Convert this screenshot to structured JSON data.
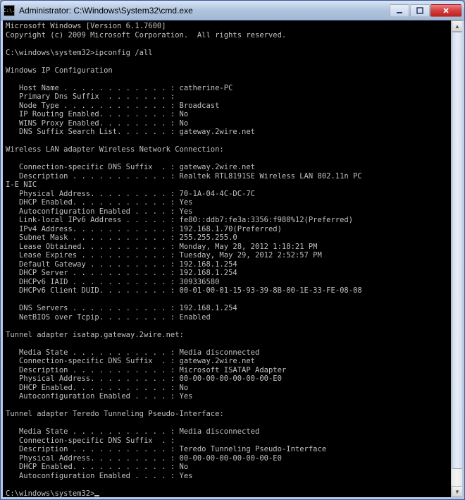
{
  "window": {
    "title": "Administrator: C:\\Windows\\System32\\cmd.exe",
    "icon_text": "C:\\."
  },
  "header": {
    "line1": "Microsoft Windows [Version 6.1.7600]",
    "line2": "Copyright (c) 2009 Microsoft Corporation.  All rights reserved."
  },
  "prompt_initial": "C:\\windows\\system32>",
  "command": "ipconfig /all",
  "sections": {
    "main_header": "Windows IP Configuration",
    "host_rows": [
      {
        "label": "Host Name . . . . . . . . . . . . :",
        "value": "catherine-PC"
      },
      {
        "label": "Primary Dns Suffix  . . . . . . . :",
        "value": ""
      },
      {
        "label": "Node Type . . . . . . . . . . . . :",
        "value": "Broadcast"
      },
      {
        "label": "IP Routing Enabled. . . . . . . . :",
        "value": "No"
      },
      {
        "label": "WINS Proxy Enabled. . . . . . . . :",
        "value": "No"
      },
      {
        "label": "DNS Suffix Search List. . . . . . :",
        "value": "gateway.2wire.net"
      }
    ],
    "wlan_header": "Wireless LAN adapter Wireless Network Connection:",
    "wlan_rows1": [
      {
        "label": "Connection-specific DNS Suffix  . :",
        "value": "gateway.2wire.net"
      },
      {
        "label": "Description . . . . . . . . . . . :",
        "value": "Realtek RTL8191SE Wireless LAN 802.11n PC"
      }
    ],
    "wlan_overflow": "I-E NIC",
    "wlan_rows2": [
      {
        "label": "Physical Address. . . . . . . . . :",
        "value": "70-1A-04-4C-DC-7C"
      },
      {
        "label": "DHCP Enabled. . . . . . . . . . . :",
        "value": "Yes"
      },
      {
        "label": "Autoconfiguration Enabled . . . . :",
        "value": "Yes"
      },
      {
        "label": "Link-local IPv6 Address . . . . . :",
        "value": "fe80::ddb7:fe3a:3356:f980%12(Preferred)"
      },
      {
        "label": "IPv4 Address. . . . . . . . . . . :",
        "value": "192.168.1.70(Preferred)"
      },
      {
        "label": "Subnet Mask . . . . . . . . . . . :",
        "value": "255.255.255.0"
      },
      {
        "label": "Lease Obtained. . . . . . . . . . :",
        "value": "Monday, May 28, 2012 1:18:21 PM"
      },
      {
        "label": "Lease Expires . . . . . . . . . . :",
        "value": "Tuesday, May 29, 2012 2:52:57 PM"
      },
      {
        "label": "Default Gateway . . . . . . . . . :",
        "value": "192.168.1.254"
      },
      {
        "label": "DHCP Server . . . . . . . . . . . :",
        "value": "192.168.1.254"
      },
      {
        "label": "DHCPv6 IAID . . . . . . . . . . . :",
        "value": "309336580"
      },
      {
        "label": "DHCPv6 Client DUID. . . . . . . . :",
        "value": "00-01-00-01-15-93-39-8B-00-1E-33-FE-08-08"
      }
    ],
    "wlan_rows3": [
      {
        "label": "DNS Servers . . . . . . . . . . . :",
        "value": "192.168.1.254"
      },
      {
        "label": "NetBIOS over Tcpip. . . . . . . . :",
        "value": "Enabled"
      }
    ],
    "isatap_header": "Tunnel adapter isatap.gateway.2wire.net:",
    "isatap_rows": [
      {
        "label": "Media State . . . . . . . . . . . :",
        "value": "Media disconnected"
      },
      {
        "label": "Connection-specific DNS Suffix  . :",
        "value": "gateway.2wire.net"
      },
      {
        "label": "Description . . . . . . . . . . . :",
        "value": "Microsoft ISATAP Adapter"
      },
      {
        "label": "Physical Address. . . . . . . . . :",
        "value": "00-00-00-00-00-00-00-E0"
      },
      {
        "label": "DHCP Enabled. . . . . . . . . . . :",
        "value": "No"
      },
      {
        "label": "Autoconfiguration Enabled . . . . :",
        "value": "Yes"
      }
    ],
    "teredo_header": "Tunnel adapter Teredo Tunneling Pseudo-Interface:",
    "teredo_rows": [
      {
        "label": "Media State . . . . . . . . . . . :",
        "value": "Media disconnected"
      },
      {
        "label": "Connection-specific DNS Suffix  . :",
        "value": ""
      },
      {
        "label": "Description . . . . . . . . . . . :",
        "value": "Teredo Tunneling Pseudo-Interface"
      },
      {
        "label": "Physical Address. . . . . . . . . :",
        "value": "00-00-00-00-00-00-00-E0"
      },
      {
        "label": "DHCP Enabled. . . . . . . . . . . :",
        "value": "No"
      },
      {
        "label": "Autoconfiguration Enabled . . . . :",
        "value": "Yes"
      }
    ]
  },
  "prompt_final": "C:\\windows\\system32>"
}
